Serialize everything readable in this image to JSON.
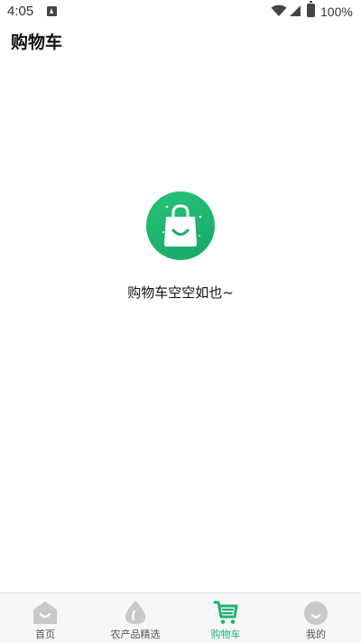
{
  "status_bar": {
    "time": "4:05",
    "battery_percent": "100%",
    "icons": [
      "notification-icon",
      "wifi-icon",
      "signal-icon",
      "battery-icon"
    ]
  },
  "header": {
    "title": "购物车"
  },
  "empty_state": {
    "icon": "shopping-bag-icon",
    "message": "购物车空空如也~"
  },
  "bottom_nav": {
    "active_index": 2,
    "items": [
      {
        "label": "首页",
        "icon": "home-icon"
      },
      {
        "label": "农产品精选",
        "icon": "drop-icon"
      },
      {
        "label": "购物车",
        "icon": "cart-icon"
      },
      {
        "label": "我的",
        "icon": "profile-icon"
      }
    ]
  },
  "colors": {
    "accent": "#1db36c",
    "inactive_icon": "#c9c9c9",
    "nav_bg": "#f7f7f7"
  }
}
